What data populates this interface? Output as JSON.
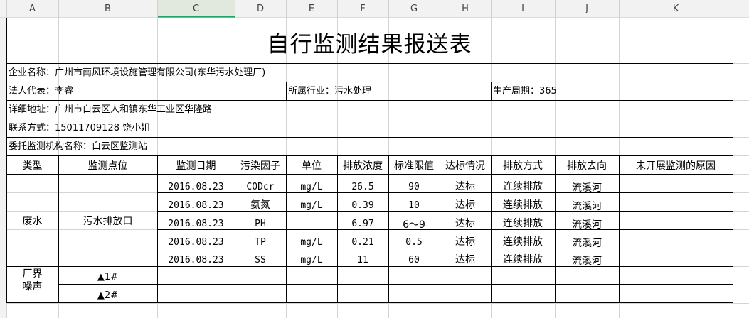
{
  "columns": [
    "A",
    "B",
    "C",
    "D",
    "E",
    "F",
    "G",
    "H",
    "I",
    "J",
    "K"
  ],
  "selected_column": "C",
  "title": "自行监测结果报送表",
  "company": "企业名称：广州市南风环境设施管理有限公司(东华污水处理厂)",
  "legal_rep": "法人代表：李睿",
  "industry": "所属行业：污水处理",
  "production_cycle": "生产周期：365",
  "address": "详细地址：广州市白云区人和镇东华工业区华隆路",
  "contact": "联系方式：15011709128 饶小姐",
  "agency": "委托监测机构名称：白云区监测站",
  "headers": [
    "类型",
    "监测点位",
    "监测日期",
    "污染因子",
    "单位",
    "排放浓度",
    "标准限值",
    "达标情况",
    "排放方式",
    "排放去向",
    "未开展监测的原因"
  ],
  "wastewater": {
    "type": "废水",
    "point": "污水排放口",
    "rows": [
      {
        "date": "2016.08.23",
        "factor": "CODcr",
        "unit": "mg/L",
        "conc": "26.5",
        "limit": "90",
        "status": "达标",
        "mode": "连续排放",
        "dest": "流溪河"
      },
      {
        "date": "2016.08.23",
        "factor": "氨氮",
        "unit": "mg/L",
        "conc": "0.39",
        "limit": "10",
        "status": "达标",
        "mode": "连续排放",
        "dest": "流溪河"
      },
      {
        "date": "2016.08.23",
        "factor": "PH",
        "unit": "",
        "conc": "6.97",
        "limit": "6～9",
        "status": "达标",
        "mode": "连续排放",
        "dest": "流溪河"
      },
      {
        "date": "2016.08.23",
        "factor": "TP",
        "unit": "mg/L",
        "conc": "0.21",
        "limit": "0.5",
        "status": "达标",
        "mode": "连续排放",
        "dest": "流溪河"
      },
      {
        "date": "2016.08.23",
        "factor": "SS",
        "unit": "mg/L",
        "conc": "11",
        "limit": "60",
        "status": "达标",
        "mode": "连续排放",
        "dest": "流溪河"
      }
    ]
  },
  "noise": {
    "type_line1": "厂界",
    "type_line2": "噪声",
    "points": [
      "▲1#",
      "▲2#"
    ]
  },
  "colors": {
    "header_bg": "#f2f2f2",
    "selected_header_bg": "#e1e9df",
    "selected_accent": "#21a366",
    "gridline": "#d4d4d4",
    "border": "#000000"
  }
}
